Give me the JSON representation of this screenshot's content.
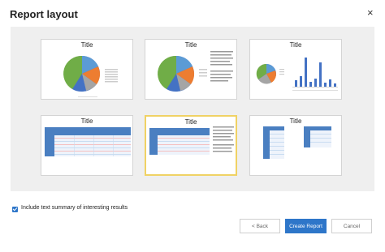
{
  "dialog": {
    "title": "Report layout",
    "close_glyph": "×"
  },
  "layouts": [
    {
      "title": "Title"
    },
    {
      "title": "Title"
    },
    {
      "title": "Title"
    },
    {
      "title": "Title"
    },
    {
      "title": "Title"
    },
    {
      "title": "Title"
    }
  ],
  "options": {
    "summary_label": "Include text summary of interesting results",
    "summary_checked": true
  },
  "buttons": {
    "back": "< Back",
    "create": "Create Report",
    "cancel": "Cancel"
  },
  "colors": {
    "accent": "#2e76c9",
    "selected_border": "#f0d264",
    "panel": "#efefef"
  }
}
